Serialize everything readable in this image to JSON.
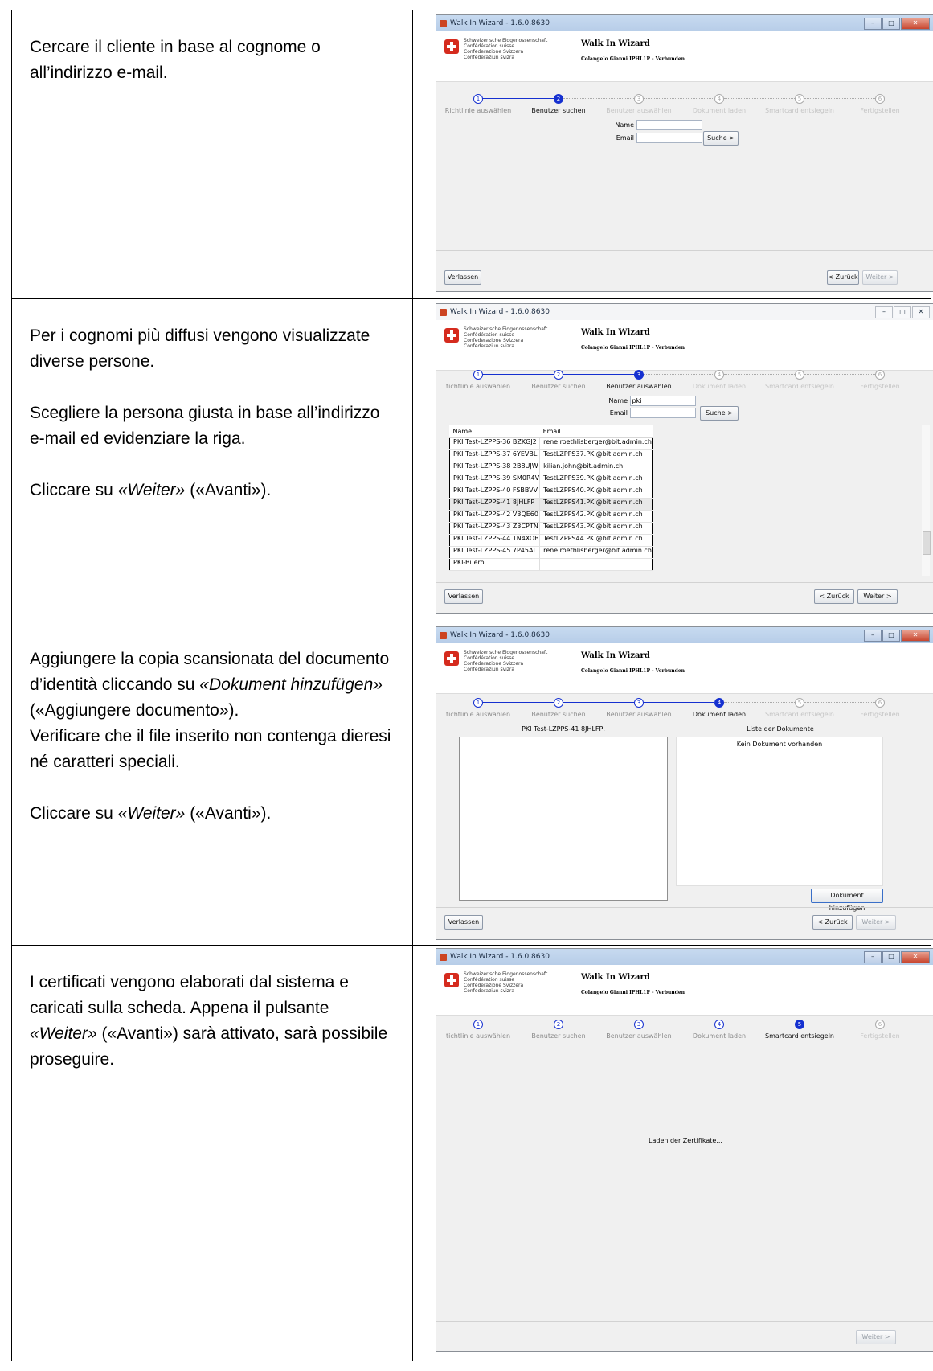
{
  "rows": [
    {
      "instruction": [
        {
          "parts": [
            {
              "t": "Cercare il cliente in base al cognome o all’indirizzo e-mail."
            }
          ]
        }
      ],
      "window": {
        "title": "Walk In Wizard - 1.6.0.8630",
        "confed_lines": [
          "Schweizerische Eidgenossenschaft",
          "Confédération suisse",
          "Confederazione Svizzera",
          "Confederaziun svizra"
        ],
        "header_title": "Walk In Wizard",
        "header_user": "Colangelo Gianni IPHL1P - Verbunden",
        "steps": [
          {
            "num": "1",
            "label": "Richtlinie auswählen",
            "state": "done"
          },
          {
            "num": "2",
            "label": "Benutzer suchen",
            "state": "active"
          },
          {
            "num": "3",
            "label": "Benutzer auswählen",
            "state": "dim"
          },
          {
            "num": "4",
            "label": "Dokument laden",
            "state": "dim"
          },
          {
            "num": "5",
            "label": "Smartcard entsiegeln",
            "state": "dim"
          },
          {
            "num": "6",
            "label": "Fertigstellen",
            "state": "dim"
          }
        ],
        "form": {
          "name_label": "Name",
          "name_value": "",
          "email_label": "Email",
          "email_value": "",
          "search_label": "Suche >"
        },
        "buttons": {
          "leave": "Verlassen",
          "back": "< Zurück",
          "next": "Weiter >"
        }
      }
    },
    {
      "instruction": [
        {
          "parts": [
            {
              "t": "Per i cognomi più diffusi vengono visualizzate diverse persone."
            }
          ]
        },
        {
          "parts": [
            {
              "t": "Scegliere la persona giusta in base all’indirizzo e-mail ed evidenziare la riga."
            }
          ]
        },
        {
          "parts": [
            {
              "t": "Cliccare su "
            },
            {
              "t": "«Weiter»",
              "em": true
            },
            {
              "t": " («Avanti»)."
            }
          ]
        }
      ],
      "window": {
        "title": "Walk In Wizard - 1.6.0.8630",
        "confed_lines": [
          "Schweizerische Eidgenossenschaft",
          "Confédération suisse",
          "Confederazione Svizzera",
          "Confederaziun svizra"
        ],
        "header_title": "Walk In Wizard",
        "header_user": "Colangelo Gianni IPHL1P - Verbunden",
        "steps": [
          {
            "num": "1",
            "label": "tichtlinie auswählen",
            "state": "done"
          },
          {
            "num": "2",
            "label": "Benutzer suchen",
            "state": "done"
          },
          {
            "num": "3",
            "label": "Benutzer auswählen",
            "state": "active"
          },
          {
            "num": "4",
            "label": "Dokument laden",
            "state": "dim"
          },
          {
            "num": "5",
            "label": "Smartcard entsiegeln",
            "state": "dim"
          },
          {
            "num": "6",
            "label": "Fertigstellen",
            "state": "dim"
          }
        ],
        "form": {
          "name_label": "Name",
          "name_value": "pki",
          "email_label": "Email",
          "email_value": "",
          "search_label": "Suche >"
        },
        "table": {
          "headers": [
            "Name",
            "Email"
          ],
          "selected_index": 5,
          "rows": [
            [
              "PKI Test-LZPPS-36 BZKGJ2",
              "rene.roethlisberger@bit.admin.ch"
            ],
            [
              "PKI Test-LZPPS-37 6YEVBL",
              "TestLZPPS37.PKI@bit.admin.ch"
            ],
            [
              "PKI Test-LZPPS-38 2B8UJW",
              "kilian.john@bit.admin.ch"
            ],
            [
              "PKI Test-LZPPS-39 SM0R4V",
              "TestLZPPS39.PKI@bit.admin.ch"
            ],
            [
              "PKI Test-LZPPS-40 FSBBVV",
              "TestLZPPS40.PKI@bit.admin.ch"
            ],
            [
              "PKI Test-LZPPS-41 8JHLFP",
              "TestLZPPS41.PKI@bit.admin.ch"
            ],
            [
              "PKI Test-LZPPS-42 V3QE60",
              "TestLZPPS42.PKI@bit.admin.ch"
            ],
            [
              "PKI Test-LZPPS-43 Z3CPTN",
              "TestLZPPS43.PKI@bit.admin.ch"
            ],
            [
              "PKI Test-LZPPS-44 TN4XOB",
              "TestLZPPS44.PKI@bit.admin.ch"
            ],
            [
              "PKI Test-LZPPS-45 7P45AL",
              "rene.roethlisberger@bit.admin.ch"
            ],
            [
              "PKI-Buero",
              ""
            ]
          ]
        },
        "buttons": {
          "leave": "Verlassen",
          "back": "< Zurück",
          "next": "Weiter >"
        }
      }
    },
    {
      "instruction": [
        {
          "parts": [
            {
              "t": "Aggiungere la copia scansionata del documento d’identità cliccando su "
            },
            {
              "t": "«Dokument hinzufügen»",
              "em": true
            },
            {
              "t": " («Aggiungere documento»)."
            },
            {
              "br": true
            },
            {
              "t": "Verificare che il file inserito non contenga dieresi né caratteri speciali."
            }
          ]
        },
        {
          "parts": [
            {
              "t": "Cliccare su "
            },
            {
              "t": "«Weiter»",
              "em": true
            },
            {
              "t": " («Avanti»)."
            }
          ]
        }
      ],
      "window": {
        "title": "Walk In Wizard - 1.6.0.8630",
        "confed_lines": [
          "Schweizerische Eidgenossenschaft",
          "Confédération suisse",
          "Confederazione Svizzera",
          "Confederaziun svizra"
        ],
        "header_title": "Walk In Wizard",
        "header_user": "Colangelo Gianni IPHL1P - Verbunden",
        "steps": [
          {
            "num": "1",
            "label": "tichtlinie auswählen",
            "state": "done"
          },
          {
            "num": "2",
            "label": "Benutzer suchen",
            "state": "done"
          },
          {
            "num": "3",
            "label": "Benutzer auswählen",
            "state": "done"
          },
          {
            "num": "4",
            "label": "Dokument laden",
            "state": "active"
          },
          {
            "num": "5",
            "label": "Smartcard entsiegeln",
            "state": "dim"
          },
          {
            "num": "6",
            "label": "Fertigstellen",
            "state": "dim"
          }
        ],
        "left_title": "PKI Test-LZPPS-41 8JHLFP,",
        "right_title": "Liste der Dokumente",
        "empty_text": "Kein Dokument vorhanden",
        "add_label": "Dokument hinzufügen",
        "buttons": {
          "leave": "Verlassen",
          "back": "< Zurück",
          "next": "Weiter >"
        }
      }
    },
    {
      "instruction": [
        {
          "parts": [
            {
              "t": "I certificati vengono elaborati dal sistema e caricati sulla scheda. Appena il pulsante "
            },
            {
              "t": "«Weiter»",
              "em": true
            },
            {
              "t": " («Avanti») sarà attivato, sarà possibile proseguire."
            }
          ]
        }
      ],
      "window": {
        "title": "Walk In Wizard - 1.6.0.8630",
        "confed_lines": [
          "Schweizerische Eidgenossenschaft",
          "Confédération suisse",
          "Confederazione Svizzera",
          "Confederaziun svizra"
        ],
        "header_title": "Walk In Wizard",
        "header_user": "Colangelo Gianni IPHL1P - Verbunden",
        "steps": [
          {
            "num": "1",
            "label": "tichtlinie auswählen",
            "state": "done"
          },
          {
            "num": "2",
            "label": "Benutzer suchen",
            "state": "done"
          },
          {
            "num": "3",
            "label": "Benutzer auswählen",
            "state": "done"
          },
          {
            "num": "4",
            "label": "Dokument laden",
            "state": "done"
          },
          {
            "num": "5",
            "label": "Smartcard entsiegeln",
            "state": "active"
          },
          {
            "num": "6",
            "label": "Fertigstellen",
            "state": "dim"
          }
        ],
        "loading_text": "Laden der Zertifikate...",
        "buttons": {
          "next": "Weiter >"
        }
      }
    }
  ]
}
